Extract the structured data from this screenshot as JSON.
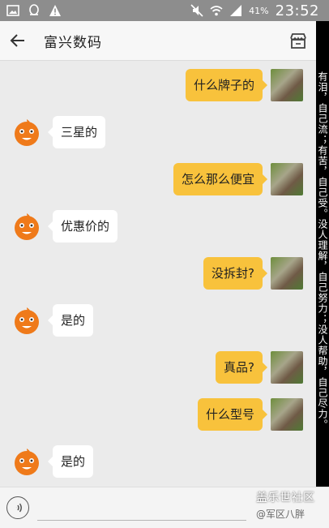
{
  "status_bar": {
    "battery": "41%",
    "time": "23:52"
  },
  "header": {
    "title": "富兴数码"
  },
  "sidebar": {
    "text": "有泪，自己流；有苦，自己受。没人理解，自己努力；没人帮助，自己尽力。"
  },
  "messages": [
    {
      "from": "me",
      "text": "什么牌子的"
    },
    {
      "from": "them",
      "text": "三星的"
    },
    {
      "from": "me",
      "text": "怎么那么便宜"
    },
    {
      "from": "them",
      "text": "优惠价的"
    },
    {
      "from": "me",
      "text": "没拆封?"
    },
    {
      "from": "them",
      "text": "是的"
    },
    {
      "from": "me",
      "text": "真品?"
    },
    {
      "from": "me",
      "text": "什么型号"
    },
    {
      "from": "them",
      "text": "是的"
    }
  ],
  "watermark": {
    "title": "盖乐世社区",
    "subtitle": "@军区八胖"
  },
  "icons": {
    "status_left": [
      "gallery-icon",
      "qq-icon",
      "warning-icon"
    ],
    "status_right": [
      "mute-icon",
      "wifi-icon",
      "signal-icon"
    ],
    "header": [
      "back-arrow-icon",
      "store-icon"
    ],
    "input": [
      "voice-icon"
    ]
  },
  "colors": {
    "status_bar": "#8d8d8d",
    "my_bubble": "#f8c23c",
    "their_bubble": "#ffffff",
    "chat_background": "#ebebeb"
  }
}
